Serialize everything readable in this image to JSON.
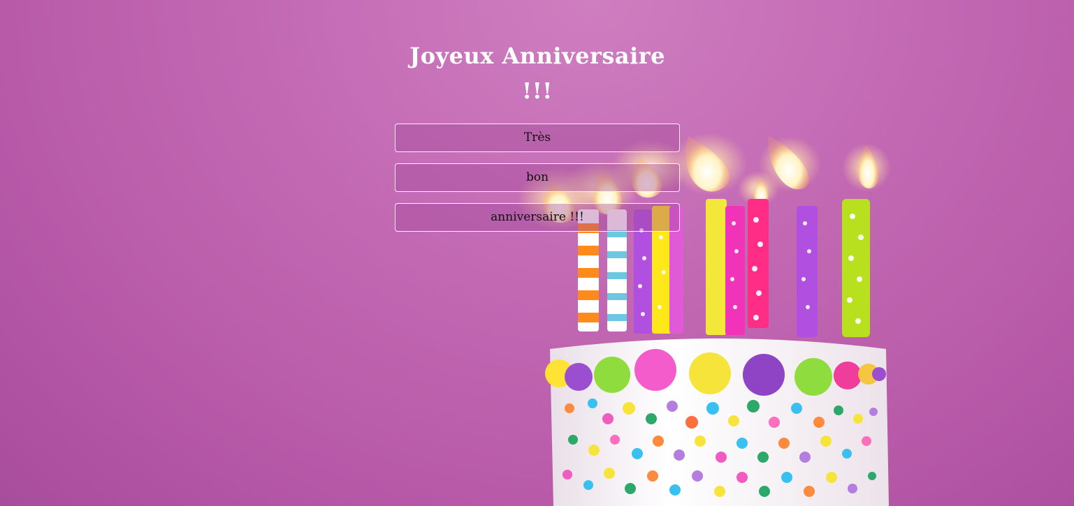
{
  "title": "Joyeux Anniversaire !!!",
  "buttons": [
    {
      "label": "Très"
    },
    {
      "label": "bon"
    },
    {
      "label": "anniversaire !!!"
    }
  ],
  "colors": {
    "background": "#c46bb5",
    "title_text": "#ffffff",
    "button_border": "#ffffff",
    "button_text": "#111111"
  }
}
